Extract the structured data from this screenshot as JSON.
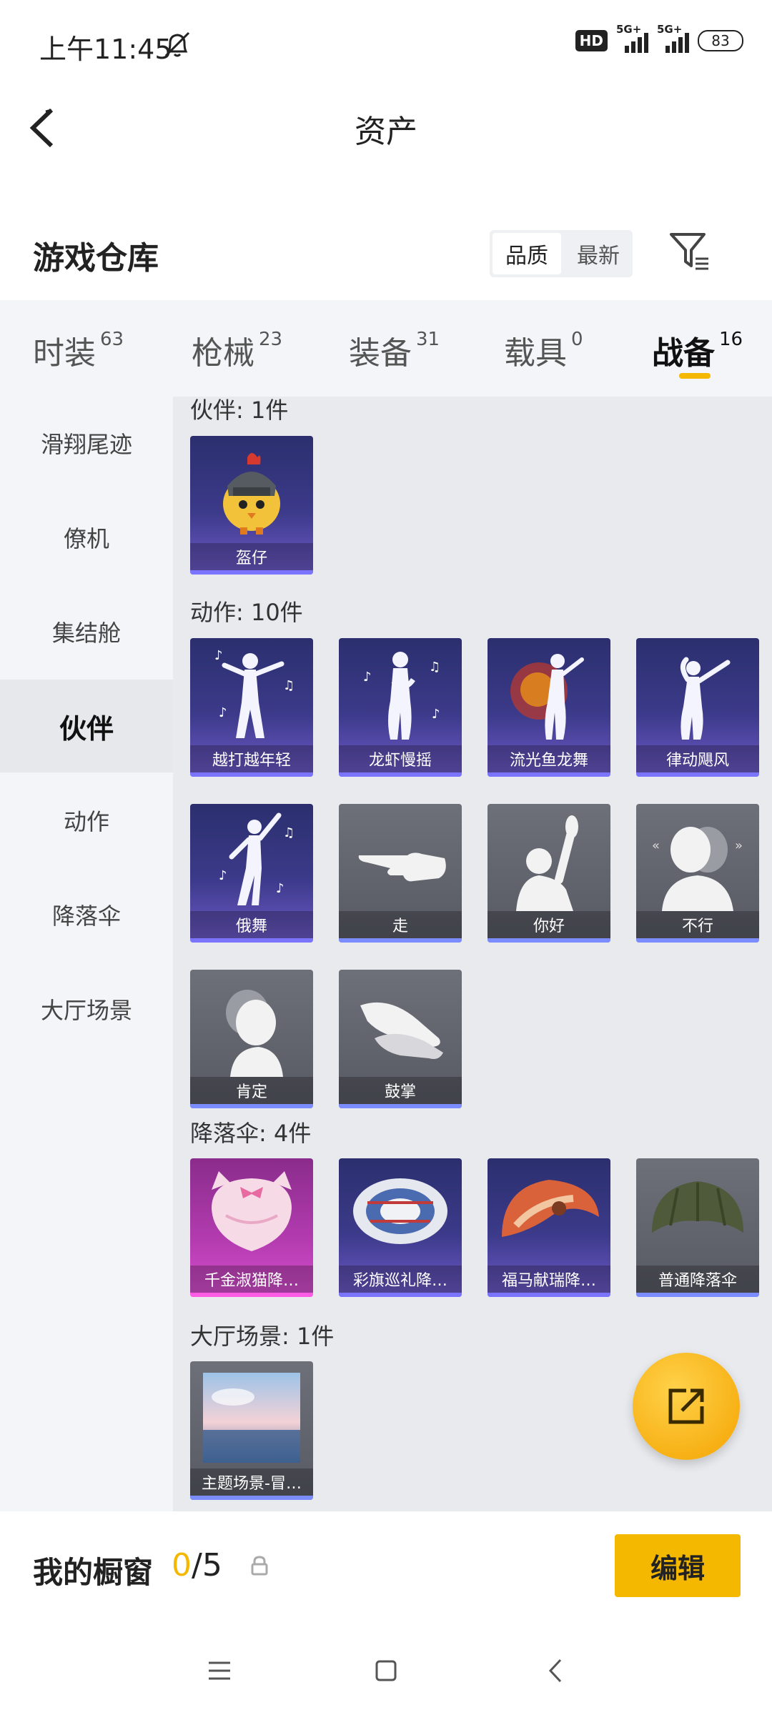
{
  "status": {
    "time": "上午11:45",
    "hd": "HD",
    "signal1": "5G+",
    "signal2": "5G+",
    "battery": "83"
  },
  "header": {
    "title": "资产"
  },
  "warehouse": {
    "title": "游戏仓库",
    "sort_quality": "品质",
    "sort_newest": "最新"
  },
  "categories": [
    {
      "label": "时装",
      "count": "63"
    },
    {
      "label": "枪械",
      "count": "23"
    },
    {
      "label": "装备",
      "count": "31"
    },
    {
      "label": "载具",
      "count": "0"
    },
    {
      "label": "战备",
      "count": "16"
    }
  ],
  "sidebar": [
    "滑翔尾迹",
    "僚机",
    "集结舱",
    "伙伴",
    "动作",
    "降落伞",
    "大厅场景"
  ],
  "sections": {
    "partner": {
      "title": "伙伴: 1件",
      "items": [
        "盔仔"
      ]
    },
    "action": {
      "title": "动作: 10件",
      "items": [
        "越打越年轻",
        "龙虾慢摇",
        "流光鱼龙舞",
        "律动飓风",
        "俄舞",
        "走",
        "你好",
        "不行",
        "肯定",
        "鼓掌"
      ]
    },
    "parachute": {
      "title": "降落伞: 4件",
      "items": [
        "千金淑猫降…",
        "彩旗巡礼降…",
        "福马献瑞降…",
        "普通降落伞"
      ]
    },
    "lobby": {
      "title": "大厅场景: 1件",
      "items": [
        "主题场景-冒…"
      ]
    }
  },
  "showcase": {
    "title": "我的橱窗",
    "current": "0",
    "sep": "/",
    "max": "5",
    "edit": "编辑"
  },
  "colors": {
    "accent": "#f5b800",
    "rare_purple": "#6f5ac9",
    "legend_pink": "#d84fd0",
    "common_gray": "#575963"
  }
}
